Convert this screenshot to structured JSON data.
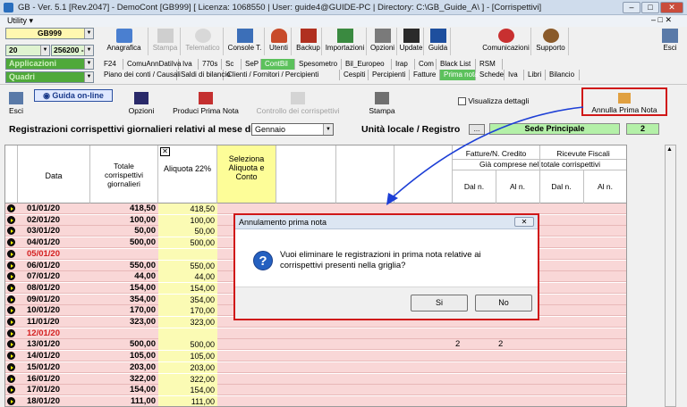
{
  "title": "GB - Ver. 5.1 [Rev.2047] - DemoCont [GB999]    [ Licenza: 1068550 | User: guide4@GUIDE-PC | Directory: C:\\GB_Guide_A\\ ] - [Corrispettivi]",
  "menu_label": "Utility",
  "selectors": {
    "company": "GB999",
    "year": "20",
    "code": "256200 -",
    "app": "Applicazioni",
    "frames": "Quadri"
  },
  "toolbar": [
    "Anagrafica",
    "Stampa",
    "Telematico",
    "Console T.",
    "Utenti",
    "Backup",
    "Importazioni",
    "Opzioni",
    "Update",
    "Guida",
    "Comunicazioni",
    "Supporto",
    "Esci"
  ],
  "tabs_row1": [
    "F24",
    "ComuAnnDatiIva",
    "Iva",
    "770s",
    "Sc",
    "SeP",
    "ContBil",
    "Spesometro",
    "Bil_Europeo",
    "Irap",
    "Com",
    "Black List",
    "RSM"
  ],
  "tabs_row2": [
    "Piano dei conti / Causali",
    "Saldi di bilancio",
    "Clienti / Fornitori / Percipienti",
    "Cespiti",
    "Percipienti",
    "Fatture",
    "Prima nota",
    "Schede",
    "Iva",
    "Libri",
    "Bilancio"
  ],
  "actions": {
    "exit": "Esci",
    "guide": "Guida on-line",
    "options": "Opzioni",
    "produce": "Produci Prima Nota",
    "control": "Controllo dei corrispettivi",
    "print": "Stampa",
    "show_details": "Visualizza dettagli",
    "cancel": "Annulla Prima Nota"
  },
  "header": {
    "title": "Registrazioni corrispettivi giornalieri relativi al mese di",
    "month": "Gennaio",
    "unit_label": "Unità locale / Registro",
    "unit_btn": "...",
    "unit_name": "Sede Principale",
    "unit_num": "2"
  },
  "columns": {
    "date": "Data",
    "total": "Totale corrispettivi giornalieri",
    "aliquota": "Aliquota 22%",
    "select": "Seleziona Aliquota e Conto",
    "fatture": "Fatture/N. Credito",
    "ricevute": "Ricevute Fiscali",
    "comprese": "Già comprese nel totale corrispettivi",
    "dal1": "Dal n.",
    "al1": "Al n.",
    "dal2": "Dal n.",
    "al2": "Al n.",
    "x": "✕"
  },
  "rows": [
    {
      "date": "01/01/20",
      "total": "418,50",
      "aliq": "418,50",
      "holiday": false
    },
    {
      "date": "02/01/20",
      "total": "100,00",
      "aliq": "100,00",
      "holiday": false
    },
    {
      "date": "03/01/20",
      "total": "50,00",
      "aliq": "50,00",
      "holiday": false
    },
    {
      "date": "04/01/20",
      "total": "500,00",
      "aliq": "500,00",
      "holiday": false
    },
    {
      "date": "05/01/20",
      "total": "",
      "aliq": "",
      "holiday": true
    },
    {
      "date": "06/01/20",
      "total": "550,00",
      "aliq": "550,00",
      "holiday": false
    },
    {
      "date": "07/01/20",
      "total": "44,00",
      "aliq": "44,00",
      "holiday": false
    },
    {
      "date": "08/01/20",
      "total": "154,00",
      "aliq": "154,00",
      "holiday": false
    },
    {
      "date": "09/01/20",
      "total": "354,00",
      "aliq": "354,00",
      "holiday": false
    },
    {
      "date": "10/01/20",
      "total": "170,00",
      "aliq": "170,00",
      "holiday": false
    },
    {
      "date": "11/01/20",
      "total": "323,00",
      "aliq": "323,00",
      "holiday": false
    },
    {
      "date": "12/01/20",
      "total": "",
      "aliq": "",
      "holiday": true
    },
    {
      "date": "13/01/20",
      "total": "500,00",
      "aliq": "500,00",
      "holiday": false,
      "dal1": "2",
      "al1": "2"
    },
    {
      "date": "14/01/20",
      "total": "105,00",
      "aliq": "105,00",
      "holiday": false
    },
    {
      "date": "15/01/20",
      "total": "203,00",
      "aliq": "203,00",
      "holiday": false
    },
    {
      "date": "16/01/20",
      "total": "322,00",
      "aliq": "322,00",
      "holiday": false
    },
    {
      "date": "17/01/20",
      "total": "154,00",
      "aliq": "154,00",
      "holiday": false
    },
    {
      "date": "18/01/20",
      "total": "111,00",
      "aliq": "111,00",
      "holiday": false
    }
  ],
  "dialog": {
    "title": "Annulamento prima nota",
    "close": "✕",
    "message": "Vuoi eliminare le registrazioni in prima nota relative ai corrispettivi presenti nella griglia?",
    "yes": "Si",
    "no": "No"
  }
}
